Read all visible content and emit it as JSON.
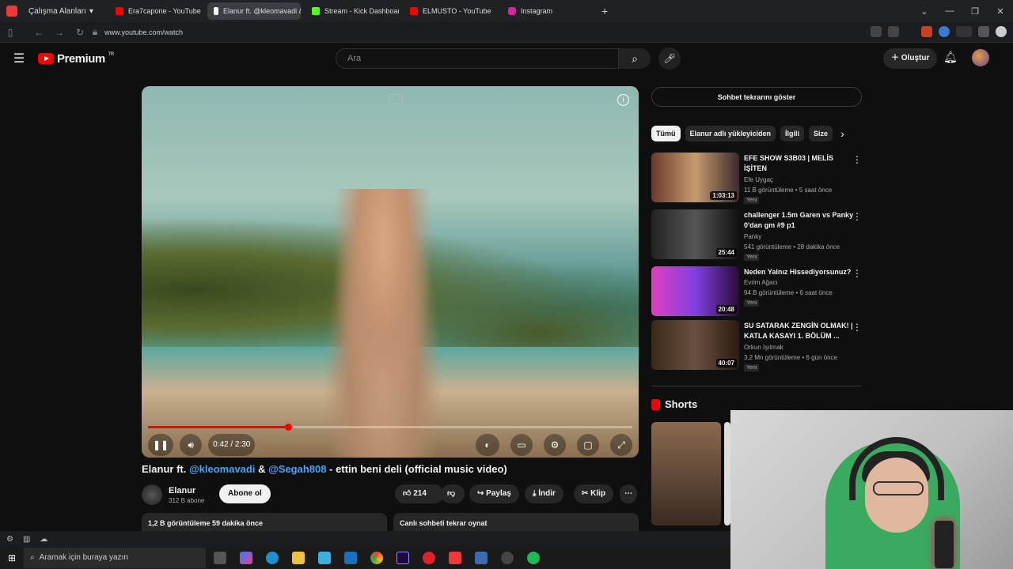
{
  "browser": {
    "workspaces_label": "Çalışma Alanları",
    "tabs": [
      {
        "label": "Era7capone - YouTube",
        "color": "#ff0000"
      },
      {
        "label": "Elanur ft. @kleomavadi & @",
        "color": "#ffffff"
      },
      {
        "label": "Stream - Kick Dashboard",
        "color": "#53fc18"
      },
      {
        "label": "ELMUSTO - YouTube",
        "color": "#ff0000"
      },
      {
        "label": "Instagram",
        "color": "#d6249f"
      }
    ],
    "url": "www.youtube.com/watch"
  },
  "header": {
    "logo_text": "Premium",
    "region": "TR",
    "search_placeholder": "Ara",
    "create_label": "Oluştur"
  },
  "player": {
    "time": "0:42 / 2:30",
    "progress": 0.29
  },
  "video": {
    "title_artist": "Elanur ft.",
    "mention1": "@kleomavadi",
    "amp": "&",
    "mention2": "@Segah808",
    "title_rest": "- ettin beni deli (official music video)",
    "channel": "Elanur",
    "subscribers": "312 B abone",
    "subscribe_label": "Abone ol",
    "likes": "214",
    "share_label": "Paylaş",
    "download_label": "İndir",
    "clip_label": "Klip",
    "views_line": "1,2 B görüntüleme  59 dakika önce",
    "chat_replay": "Canlı sohbeti tekrar oynat"
  },
  "sidebar": {
    "chat_button": "Sohbet tekrarını göster",
    "chips": [
      "Tümü",
      "Elanur adlı yükleyiciden",
      "İlgili",
      "Size"
    ],
    "recs": [
      {
        "title": "EFE SHOW S3B03 | MELİS İŞİTEN",
        "channel": "Efe Uygaç",
        "meta": "11 B görüntüleme • 5 saat önce",
        "badge": "Yeni",
        "duration": "1:03:13"
      },
      {
        "title": "challenger 1.5m Garen vs Panky 0'dan gm #9 p1",
        "channel": "Panky",
        "meta": "541 görüntüleme • 28 dakika önce",
        "badge": "Yeni",
        "duration": "25:44"
      },
      {
        "title": "Neden Yalnız Hissediyorsunuz?",
        "channel": "Evrim Ağacı",
        "meta": "94 B görüntüleme • 6 saat önce",
        "badge": "Yeni",
        "duration": "20:48"
      },
      {
        "title": "SU SATARAK ZENGİN OLMAK! | KATLA KASAYI 1. BÖLÜM ...",
        "channel": "Orkun Işıtmak",
        "meta": "3,2 Mn görüntüleme • 6 gün önce",
        "badge": "Yeni",
        "duration": "40:07"
      }
    ],
    "shorts_label": "Shorts"
  },
  "taskbar": {
    "search_text": "Aramak için buraya yazın"
  }
}
